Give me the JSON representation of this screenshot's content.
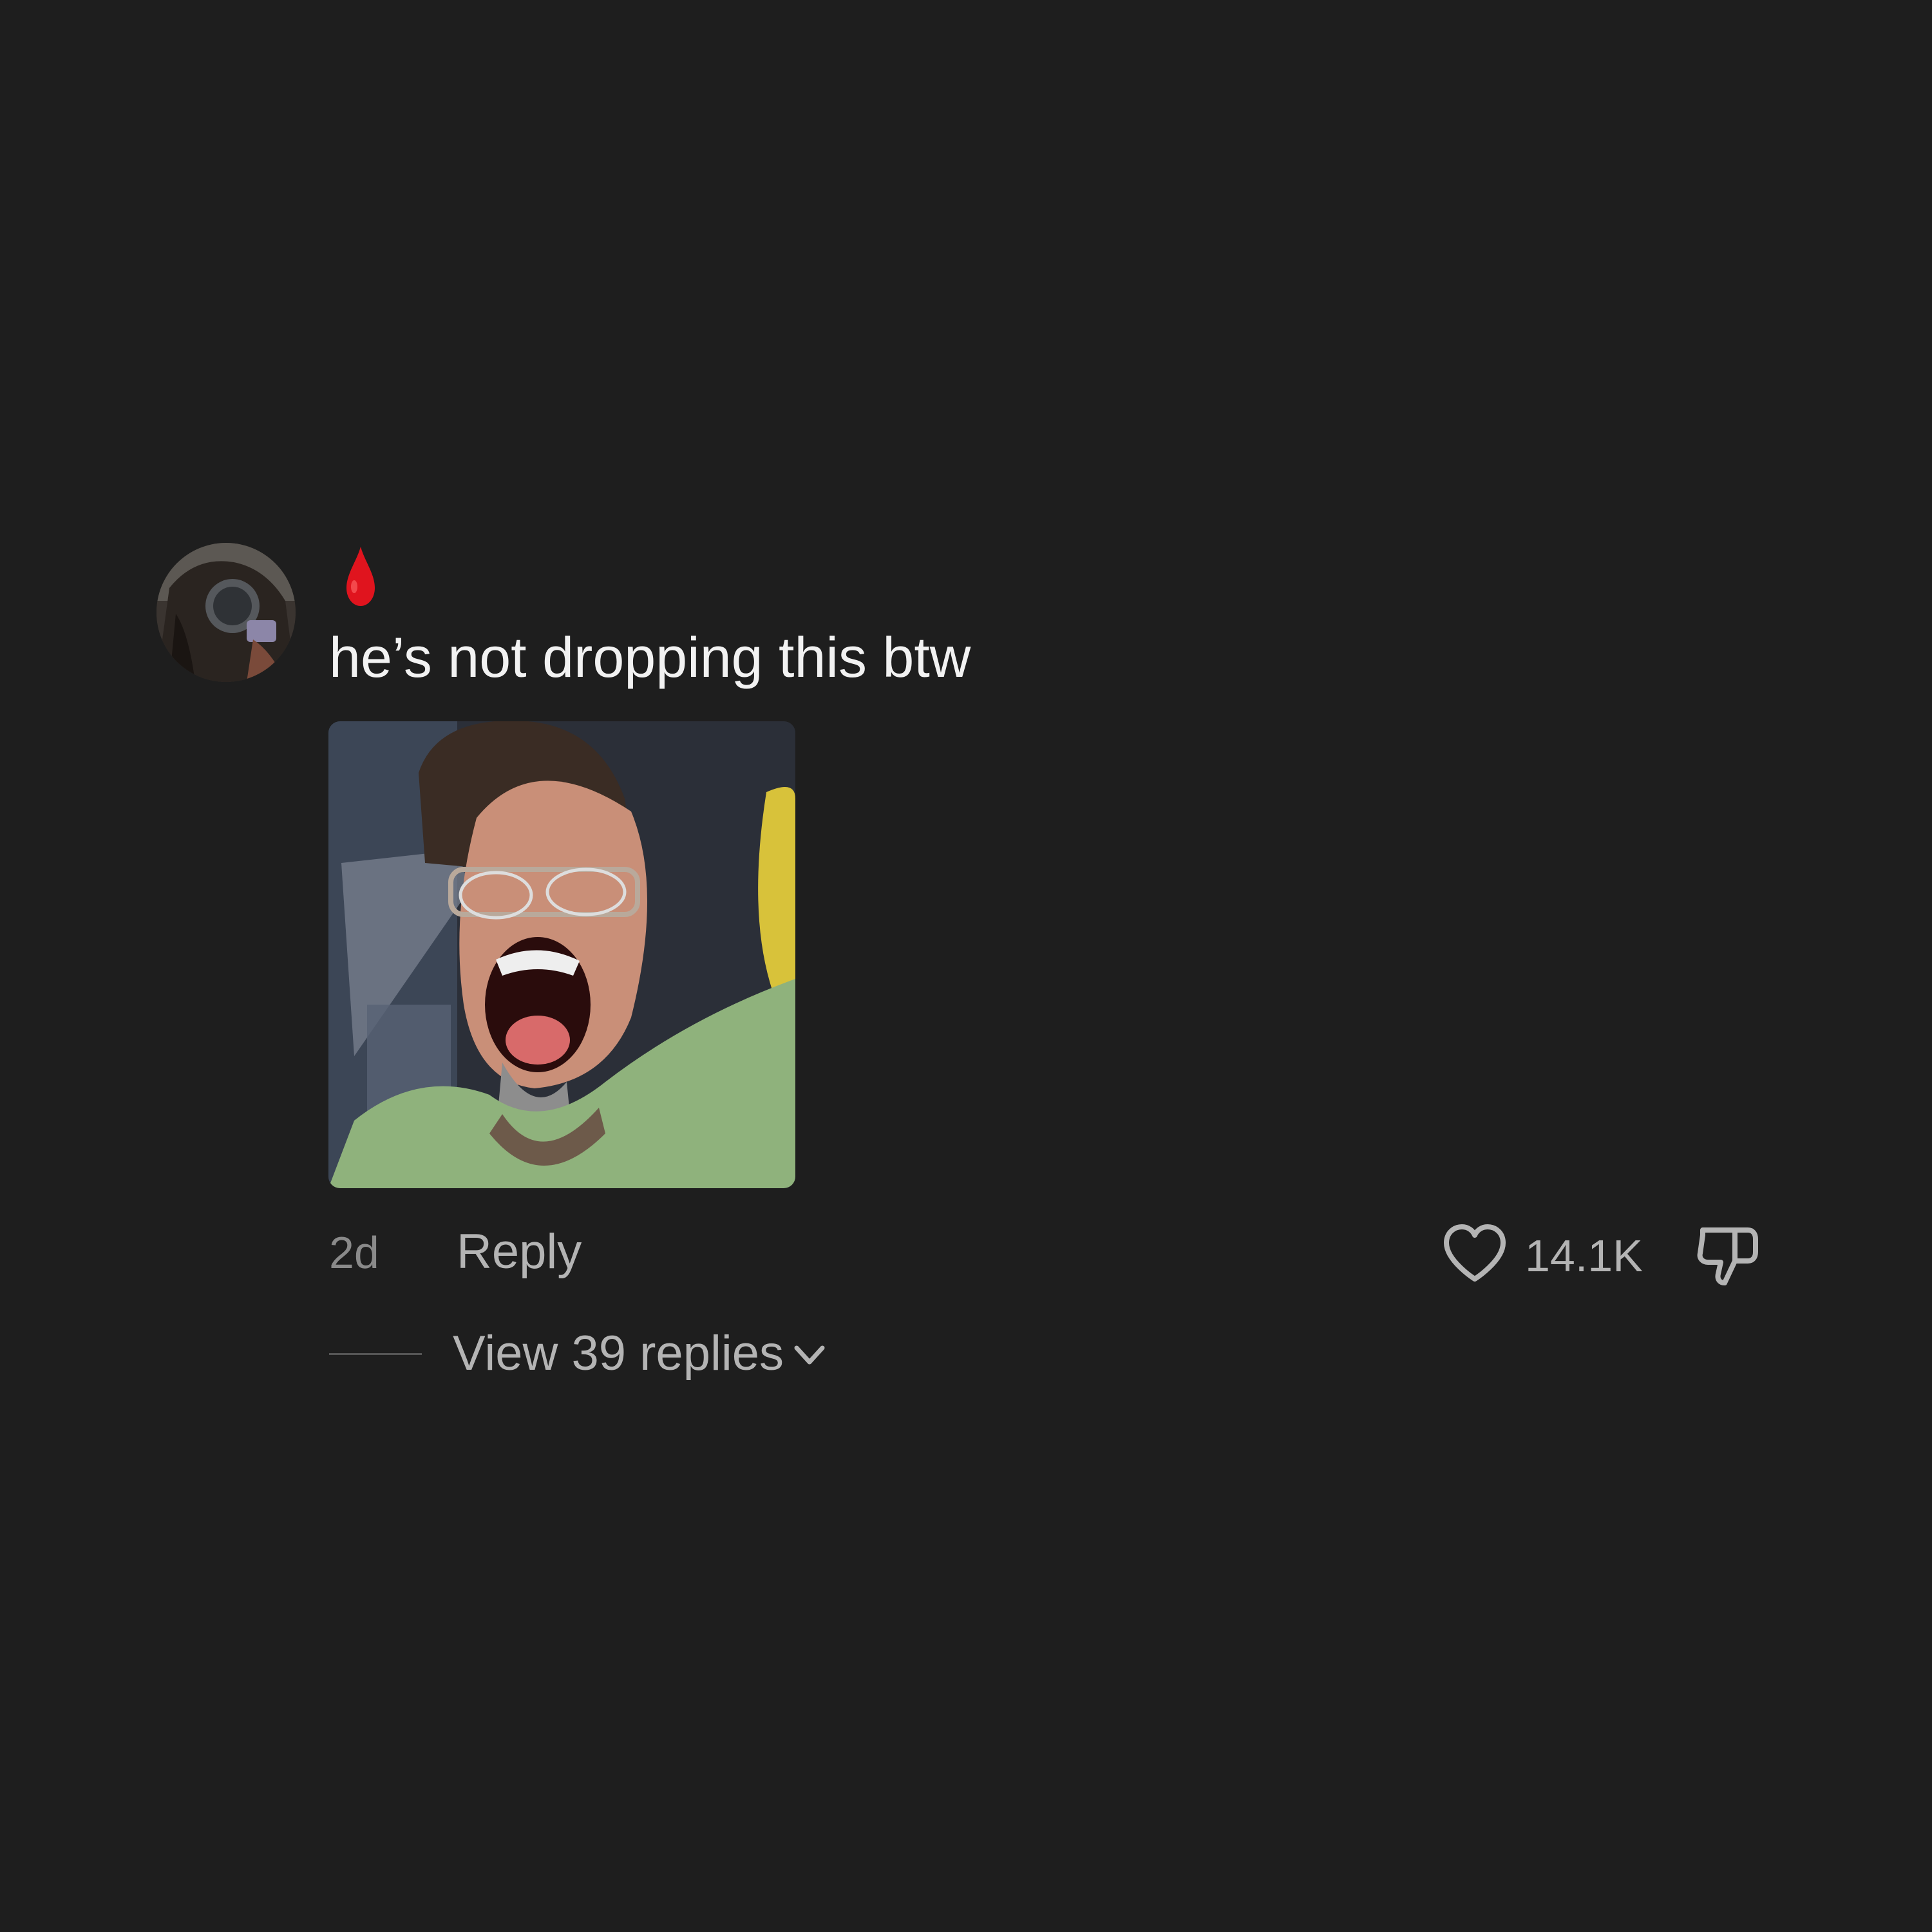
{
  "comment": {
    "username_icon": "blood-drop-emoji",
    "text": "he’s not dropping this btw",
    "media_description_icon": "reaction-image",
    "time": "2d",
    "reply_label": "Reply",
    "like_icon": "heart-outline-icon",
    "like_count": "14.1K",
    "dislike_icon": "thumbs-down-outline-icon",
    "view_replies_label": "View 39 replies",
    "view_replies_icon": "chevron-down-icon"
  },
  "colors": {
    "background": "#1e1e1e",
    "text_primary": "#f2f2f2",
    "text_secondary": "#b4b4b4",
    "text_muted": "#8a8a8a",
    "emoji_red": "#e0141e"
  }
}
